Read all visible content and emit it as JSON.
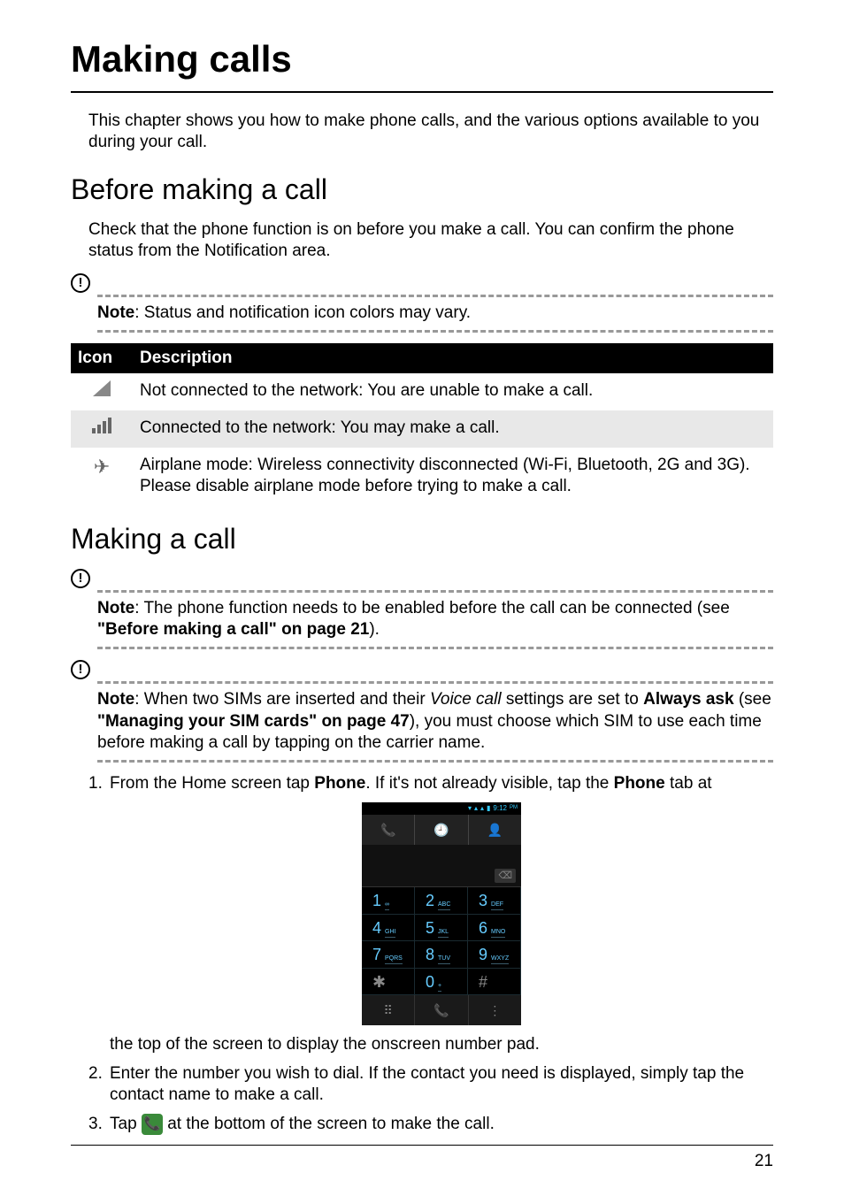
{
  "title": "Making calls",
  "intro": "This chapter shows you how to make phone calls, and the various options available to you during your call.",
  "section1": {
    "title": "Before making a call",
    "body": "Check that the phone function is on before you make a call. You can confirm the phone status from the Notification area.",
    "note_label": "Note",
    "note_text": ": Status and notification icon colors may vary."
  },
  "table": {
    "header_icon": "Icon",
    "header_desc": "Description",
    "row1": "Not connected to the network: You are unable to make a call.",
    "row2": "Connected to the network: You may make a call.",
    "row3": "Airplane mode: Wireless connectivity disconnected (Wi-Fi, Bluetooth, 2G and 3G). Please disable airplane mode before trying to make a call."
  },
  "section2": {
    "title": "Making a call",
    "note1_label": "Note",
    "note1_a": ": The phone function needs to be enabled before the call can be connected (see ",
    "note1_b": "\"Before making a call\" on page 21",
    "note1_c": ").",
    "note2_label": "Note",
    "note2_a": ": When two SIMs are inserted and their ",
    "note2_b": "Voice call",
    "note2_c": " settings are set to ",
    "note2_d": "Always ask",
    "note2_e": " (see ",
    "note2_f": "\"Managing your SIM cards\" on page 47",
    "note2_g": "), you must choose which SIM to use each time before making a call by tapping on the carrier name."
  },
  "steps": {
    "s1_num": "1.",
    "s1_a": "From the Home screen tap ",
    "s1_b": "Phone",
    "s1_c": ". If it's not already visible, tap the ",
    "s1_d": "Phone",
    "s1_e": " tab at the top of the screen to display the onscreen number pad.",
    "s2_num": "2.",
    "s2": "Enter the number you wish to dial. If the contact you need is displayed, simply tap the contact name to make a call.",
    "s3_num": "3.",
    "s3_a": "Tap ",
    "s3_b": " at the bottom of the screen to make the call."
  },
  "phone_ui": {
    "time": "9:12",
    "pm": "PM",
    "keys": [
      {
        "n": "1",
        "l": "∞"
      },
      {
        "n": "2",
        "l": "ABC"
      },
      {
        "n": "3",
        "l": "DEF"
      },
      {
        "n": "4",
        "l": "GHI"
      },
      {
        "n": "5",
        "l": "JKL"
      },
      {
        "n": "6",
        "l": "MNO"
      },
      {
        "n": "7",
        "l": "PQRS"
      },
      {
        "n": "8",
        "l": "TUV"
      },
      {
        "n": "9",
        "l": "WXYZ"
      },
      {
        "n": "✱",
        "l": ""
      },
      {
        "n": "0",
        "l": "+"
      },
      {
        "n": "#",
        "l": ""
      }
    ]
  },
  "page_number": "21"
}
